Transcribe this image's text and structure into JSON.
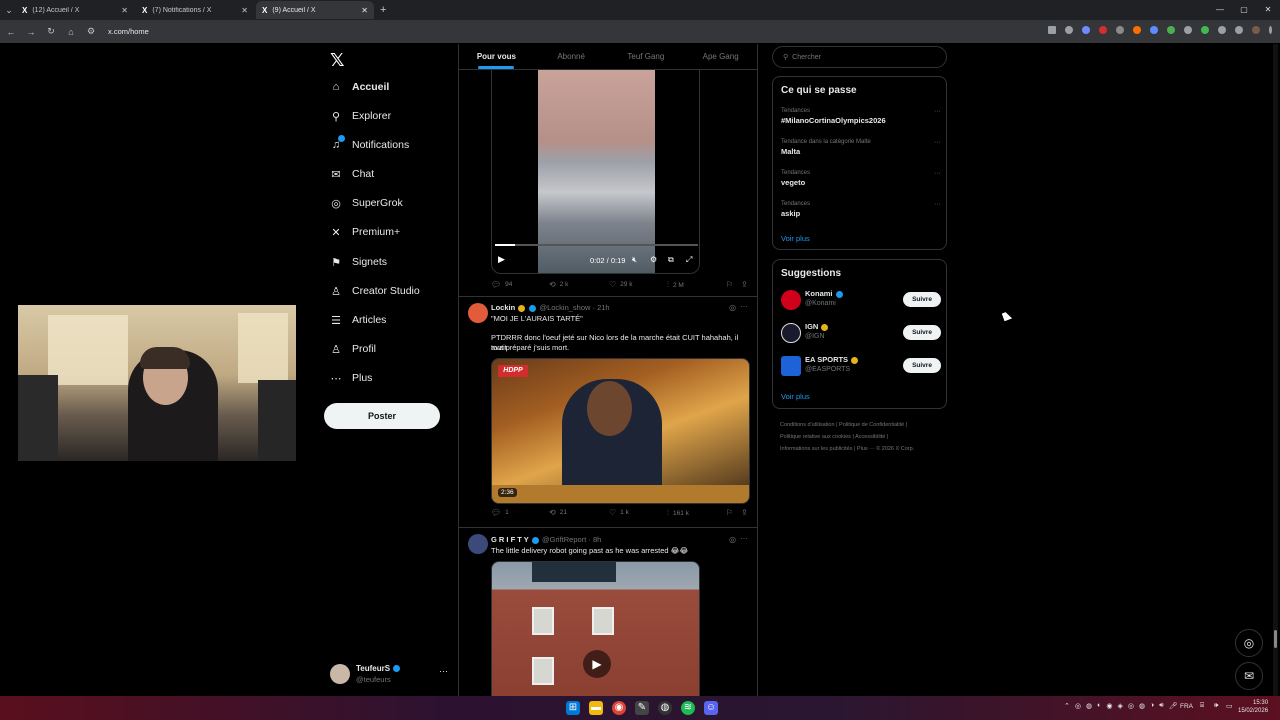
{
  "browser": {
    "tabs": [
      {
        "title": "(12) Accueil / X",
        "active": false
      },
      {
        "title": "(7) Notifications / X",
        "active": false
      },
      {
        "title": "(9) Accueil / X",
        "active": true
      }
    ],
    "new_tab": "+",
    "url": "x.com/home"
  },
  "nav": {
    "logo": "𝕏",
    "items": [
      {
        "label": "Accueil",
        "icon": "home-icon",
        "glyph": "⌂"
      },
      {
        "label": "Explorer",
        "icon": "search-icon",
        "glyph": "⚲"
      },
      {
        "label": "Notifications",
        "icon": "bell-icon",
        "glyph": "♫"
      },
      {
        "label": "Chat",
        "icon": "mail-icon",
        "glyph": "✉"
      },
      {
        "label": "SuperGrok",
        "icon": "grok-icon",
        "glyph": "◎"
      },
      {
        "label": "Premium+",
        "icon": "x-premium-icon",
        "glyph": "✕"
      },
      {
        "label": "Signets",
        "icon": "bookmark-icon",
        "glyph": "⚑"
      },
      {
        "label": "Creator Studio",
        "icon": "creator-icon",
        "glyph": "♙"
      },
      {
        "label": "Articles",
        "icon": "articles-icon",
        "glyph": "☰"
      },
      {
        "label": "Profil",
        "icon": "profile-icon",
        "glyph": "♙"
      },
      {
        "label": "Plus",
        "icon": "more-circle-icon",
        "glyph": "⋯"
      }
    ],
    "post_button": "Poster"
  },
  "account": {
    "name": "TeufeurS",
    "handle": "@teufeurs",
    "more": "···"
  },
  "timeline": {
    "tabs": [
      "Pour vous",
      "Abonné",
      "Teuf Gang",
      "Ape Gang"
    ],
    "video1": {
      "time": "0:02 / 0:19",
      "progress": 0.1,
      "actions": {
        "replies": "94",
        "reposts": "2 k",
        "likes": "29 k",
        "views": "2 M"
      }
    },
    "post2": {
      "name": "Lockin",
      "handle": "@Lockin_show · 21h",
      "line1": "\"MOI JE L'AURAIS TARTÉ\"",
      "line2": "PTDRRR donc l'oeuf jeté sur Nico lors de la marche était CUIT hahahah, il avait",
      "line3": "tout préparé j'suis mort.",
      "media_logo": "HDPP",
      "duration": "2:36",
      "actions": {
        "replies": "1",
        "reposts": "21",
        "likes": "1 k",
        "views": "161 k"
      }
    },
    "post3": {
      "name": "G R I F T Y",
      "handle": "@GriftReport · 8h",
      "text": "The little delivery robot going past as he was arrested 😂😂"
    }
  },
  "sidebar": {
    "search_placeholder": "Chercher",
    "trends_title": "Ce qui se passe",
    "trends": [
      {
        "category": "Tendances",
        "name": "#MilanoCortinaOlympics2026"
      },
      {
        "category": "Tendance dans la catégorie Malte",
        "name": "Malta"
      },
      {
        "category": "Tendances",
        "name": "vegeto"
      },
      {
        "category": "Tendances",
        "name": "askip"
      }
    ],
    "trends_more": "Voir plus",
    "suggestions_title": "Suggestions",
    "suggestions": [
      {
        "name": "Konami",
        "handle": "@Konami",
        "button": "Suivre",
        "color": "#d0021b"
      },
      {
        "name": "IGN",
        "handle": "@IGN",
        "button": "Suivre",
        "color": "#1a1a2e"
      },
      {
        "name": "EA SPORTS",
        "handle": "@EASPORTS",
        "button": "Suivre",
        "color": "#1e62d8"
      }
    ],
    "suggestions_more": "Voir plus",
    "footer": {
      "line1": "Conditions d'utilisation  |  Politique de Confidentialité  |",
      "line2": "Politique relative aux cookies  |  Accessibilité  |",
      "line3": "Informations sur les publicités  |  Plus ···  © 2026 X Corp."
    }
  },
  "taskbar": {
    "lang": "FRA",
    "time": "15:30",
    "date": "15/02/2026"
  }
}
